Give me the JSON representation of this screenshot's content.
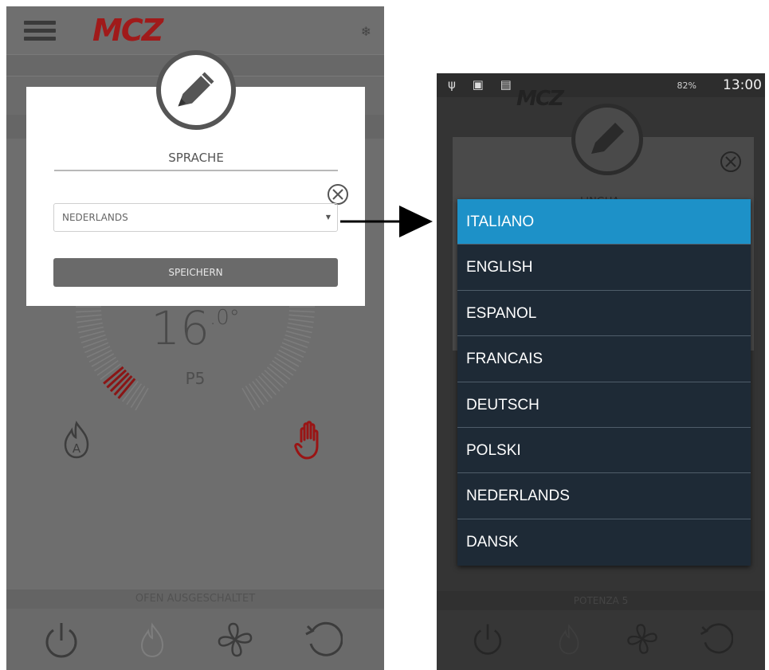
{
  "left_screen": {
    "brand": "MCZ",
    "temperature": {
      "value": "16",
      "decimal": ".0°"
    },
    "power_level": "P5",
    "status_text": "OFEN AUSGESCHALTET",
    "modal": {
      "title": "SPRACHE",
      "selected_language": "NEDERLANDS",
      "save_label": "SPEICHERN"
    },
    "accent_color": "#a01a1a"
  },
  "right_screen": {
    "status_bar": {
      "left_icons": "ψ ▣ ▤",
      "battery": "82%",
      "time": "13:00"
    },
    "brand": "MCZ",
    "modal_title_peek": "LINGUA",
    "status_text": "POTENZA 5",
    "languages": [
      "ITALIANO",
      "ENGLISH",
      "ESPANOL",
      "FRANCAIS",
      "DEUTSCH",
      "POLSKI",
      "NEDERLANDS",
      "DANSK"
    ],
    "selected_index": 0,
    "highlight_color": "#1d91c8"
  },
  "icons": [
    "menu-icon",
    "snowflake-icon",
    "pencil-icon",
    "close-icon",
    "flame-auto-icon",
    "hand-icon",
    "power-icon",
    "flame-icon",
    "fan-icon",
    "refresh-icon",
    "arrow-icon"
  ]
}
